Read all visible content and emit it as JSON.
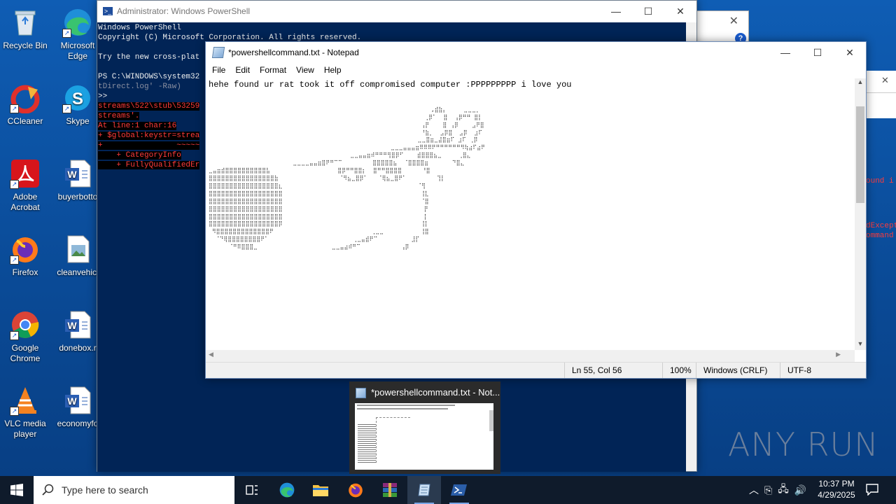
{
  "desktop": {
    "icons": [
      {
        "label": "Recycle Bin",
        "shortcut": false
      },
      {
        "label": "Microsoft Edge",
        "shortcut": true
      },
      {
        "label": "CCleaner",
        "shortcut": true
      },
      {
        "label": "Skype",
        "shortcut": true
      },
      {
        "label": "Adobe Acrobat",
        "shortcut": true
      },
      {
        "label": "buyerbotto",
        "shortcut": false
      },
      {
        "label": "Firefox",
        "shortcut": true
      },
      {
        "label": "cleanvehicl",
        "shortcut": false
      },
      {
        "label": "Google Chrome",
        "shortcut": true
      },
      {
        "label": "donebox.r",
        "shortcut": false
      },
      {
        "label": "VLC media player",
        "shortcut": true
      },
      {
        "label": "economyfo",
        "shortcut": false
      }
    ],
    "watermark": "ANY RUN"
  },
  "powershell": {
    "title": "Administrator: Windows PowerShell",
    "lines": [
      {
        "text": "Windows PowerShell",
        "cls": ""
      },
      {
        "text": "Copyright (C) Microsoft Corporation. All rights reserved.",
        "cls": ""
      },
      {
        "text": "",
        "cls": ""
      },
      {
        "text": "Try the new cross-plat",
        "cls": ""
      },
      {
        "text": "",
        "cls": ""
      },
      {
        "text": "PS C:\\WINDOWS\\system32",
        "cls": ""
      },
      {
        "text": "tDirect.log' -Raw)",
        "cls": "dim"
      },
      {
        "text": ">>",
        "cls": ""
      },
      {
        "text": "streams\\522\\stub\\53259",
        "cls": "err"
      },
      {
        "text": "streams'.",
        "cls": "err"
      },
      {
        "text": "At line:1 char:16",
        "cls": "err"
      },
      {
        "text": "+ $global:keystr=strea",
        "cls": "err"
      },
      {
        "text": "+                ~~~~~",
        "cls": "err"
      },
      {
        "text": "    + CategoryInfo",
        "cls": "err"
      },
      {
        "text": "    + FullyQualifiedEr",
        "cls": "err"
      }
    ],
    "right_fragments": [
      "ound i",
      "dExcept",
      "ommand"
    ]
  },
  "notepad": {
    "title": "*powershellcommand.txt - Notepad",
    "menu": [
      "File",
      "Edit",
      "Format",
      "View",
      "Help"
    ],
    "first_line": "hehe found ur rat took it off compromised computer :PPPPPPPPP i love you",
    "art": "\n\n                                                                  ,⣾⣷⡄     ⣀⣀⣀⡀\n                                                                ⢀⡿⠁  ⣿  ⢠⡿⠛⠛ ⣿⡇\n                                                               ⢠⡟    ⣿ ⢠⡿    ⣠⠟⣿\n                                                               ⠘⣷⡀  ⣠⡿⣿  ⣠⡿  ⣰⠏\n                                                              ⣀⣀⣿⣶⣀⣼⣿⣶⠏ ⣰⠏ ⢀⡿\n                                                      ⣀⣀⣀⣤⣤⣤⣶⠿⠿⠿⠟⠛⠛⠛⠛⠛⠛⠻⢷⣴⠏⣴⠟\n                                          ⣀⣀⣤⣤⣶⠾⠛⠛⠛⢻⣿⡿⠋    ⣾⣿⣿⣿⣦⣀     ⢀⣿⣄\n                         ⣀⣀⣀⣀⣤⣤⣶⣿⠟⠛⠉⠉         ⣿⣿⣿⣿⣿⣦  ⠈⣿⣿⣿⣿⣶       ⠙⣿⣄\n⣀⣤⣶⣾⣿⣿⣿⣿⣿⣿⣿⣿⣿⣿⣧                    ⣿⡿⠛⠛⣿⣿⡆  ⣿⠛⠛⣿⣿⣿⣿      ⠘⣿\n⣿⣿⣿⣿⣿⣿⣿⣿⣿⣿⣿⣿⣿⣿⣿⣿⣷                  ⠈⠻⣦⣀⣿⡿⠁   ⠈⢿⣦⣀⣿⠟⠁         ⢹⡇\n⣿⣿⣿⣿⣿⣿⣿⣿⣿⣿⣿⣿⣿⣿⣿⣿⣿⣆                                        ⠈⢻\n⣿⣿⣿⣿⣿⣿⣿⣿⣿⣿⣿⣿⣿⣿⣿⣿⣿⣿                                         ⢸⣇\n⣿⣿⣿⣿⣿⣿⣿⣿⣿⣿⣿⣿⣿⣿⣿⣿⣿⣿                                         ⠈⣿\n⣿⣿⣿⣿⣿⣿⣿⣿⣿⣿⣿⣿⣿⣿⣿⣿⣿⣿                                          ⡟\n⣿⣿⣿⣿⣿⣿⣿⣿⣿⣿⣿⣿⣿⣿⣿⣿⣿⣿                                          ⡇\n⣿⣿⣿⣿⣿⣿⣿⣿⣿⣿⣿⣿⣿⣿⣿⣿⣿⡿                                         ⢸⡇\n ⠻⣿⣿⣿⣿⣿⣿⣿⣿⣿⣿⣿⣿⣿⠟                             ⢀⣀⣀           ⢸⣿\n  ⠈⠙⢿⣿⣿⣿⣿⣿⣿⣿⣿⠟⠁                         ⢀⣀⣤⣾⠟⠉          ⣸⡏\n      ⠈⠛⠿⣿⣿⣿⣀                      ⣀⣀⣤⣴⠾⠛⠉            ⢠⡿",
    "status": {
      "position": "Ln 55, Col 56",
      "zoom": "100%",
      "line_ending": "Windows (CRLF)",
      "encoding": "UTF-8"
    }
  },
  "thumbnail": {
    "title": "*powershellcommand.txt - Not..."
  },
  "taskbar": {
    "search_placeholder": "Type here to search",
    "time": "10:37 PM",
    "date": "4/29/2025"
  }
}
